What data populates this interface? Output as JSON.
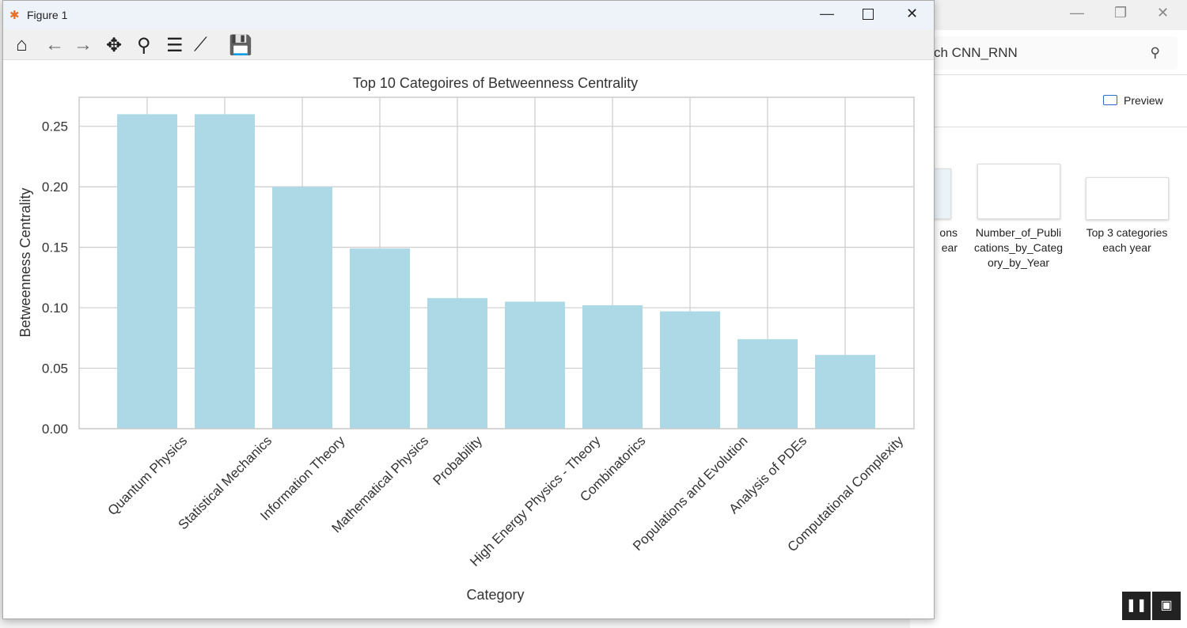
{
  "window": {
    "title": "Figure 1"
  },
  "toolbar": {
    "icons": [
      "home-icon",
      "back-icon",
      "forward-icon",
      "pan-icon",
      "zoom-icon",
      "configure-subplots-icon",
      "edit-axis-icon",
      "save-icon"
    ]
  },
  "explorer": {
    "search_text": "ch CNN_RNN",
    "preview_label": "Preview",
    "files": [
      {
        "name": "ons\near"
      },
      {
        "name": "Number_of_Publi\ncations_by_Categ\nory_by_Year"
      },
      {
        "name": "Top 3 categories\neach year"
      }
    ]
  },
  "chart_data": {
    "type": "bar",
    "title": "Top 10 Categoires of Betweenness Centrality",
    "xlabel": "Category",
    "ylabel": "Betweenness Centrality",
    "categories": [
      "Quantum Physics",
      "Statistical Mechanics",
      "Information Theory",
      "Mathematical Physics",
      "Probability",
      "High Energy Physics - Theory",
      "Combinatorics",
      "Populations and Evolution",
      "Analysis of PDEs",
      "Computational Complexity"
    ],
    "values": [
      0.26,
      0.26,
      0.2,
      0.149,
      0.108,
      0.105,
      0.102,
      0.097,
      0.074,
      0.061
    ],
    "ylim": [
      0,
      0.274
    ],
    "yticks": [
      "0.00",
      "0.05",
      "0.10",
      "0.15",
      "0.20",
      "0.25"
    ],
    "grid": true,
    "bar_color": "#add8e6",
    "tick_label_rotation": 45
  }
}
